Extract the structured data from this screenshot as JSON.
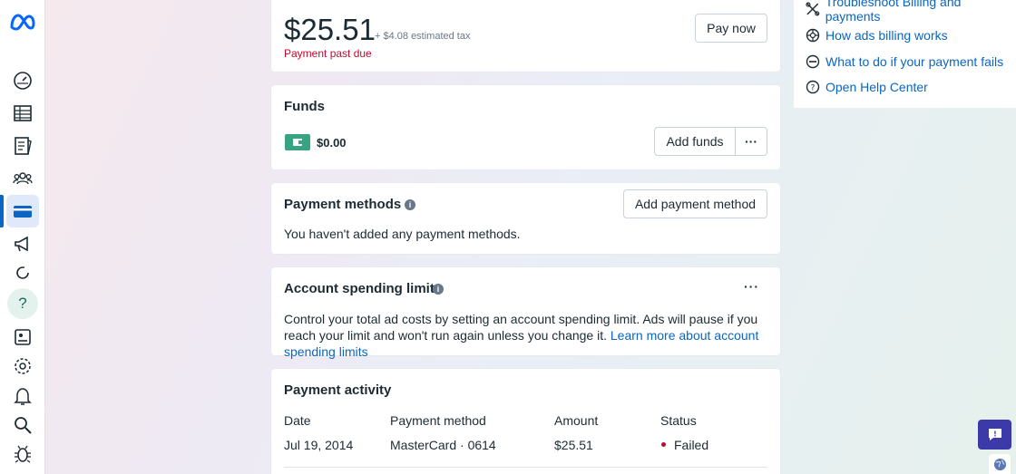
{
  "sidebar": {
    "logo": "meta-logo",
    "items": [
      {
        "name": "dashboard-icon"
      },
      {
        "name": "table-icon"
      },
      {
        "name": "catalog-icon"
      },
      {
        "name": "audiences-icon"
      },
      {
        "name": "billing-card-icon",
        "active": true
      },
      {
        "name": "megaphone-icon"
      },
      {
        "name": "loading-icon"
      },
      {
        "name": "help-icon",
        "label": "?"
      },
      {
        "name": "pages-icon"
      },
      {
        "name": "settings-icon"
      },
      {
        "name": "notifications-icon"
      },
      {
        "name": "search-icon"
      },
      {
        "name": "bug-icon"
      }
    ]
  },
  "balance": {
    "amount": "$25.51",
    "tax": "+ $4.08 estimated tax",
    "status": "Payment past due",
    "pay_button": "Pay now"
  },
  "funds": {
    "title": "Funds",
    "amount": "$0.00",
    "add_button": "Add funds",
    "more": "···"
  },
  "payment_methods": {
    "title": "Payment methods",
    "info": "i",
    "add_button": "Add payment method",
    "empty_text": "You haven't added any payment methods."
  },
  "spending_limit": {
    "title": "Account spending limit",
    "info": "i",
    "more": "···",
    "text": "Control your total ad costs by setting an account spending limit. Ads will pause if you reach your limit and won't run again unless you change it.",
    "link": "Learn more about account spending limits"
  },
  "payment_activity": {
    "title": "Payment activity",
    "columns": [
      "Date",
      "Payment method",
      "Amount",
      "Status"
    ],
    "rows": [
      {
        "date": "Jul 19, 2014",
        "method": "MasterCard · 0614",
        "amount": "$25.51",
        "status": "Failed"
      }
    ]
  },
  "help": {
    "items": [
      {
        "icon": "tools-icon",
        "label": "Troubleshoot Billing and payments"
      },
      {
        "icon": "billing-wheel-icon",
        "label": "How ads billing works"
      },
      {
        "icon": "minus-circle-icon",
        "label": "What to do if your payment fails"
      },
      {
        "icon": "question-circle-icon",
        "label": "Open Help Center"
      }
    ]
  },
  "colors": {
    "accent": "#0a66c2",
    "danger": "#c4082d",
    "funds_green": "#36a482",
    "chat": "#3b3aa8"
  }
}
